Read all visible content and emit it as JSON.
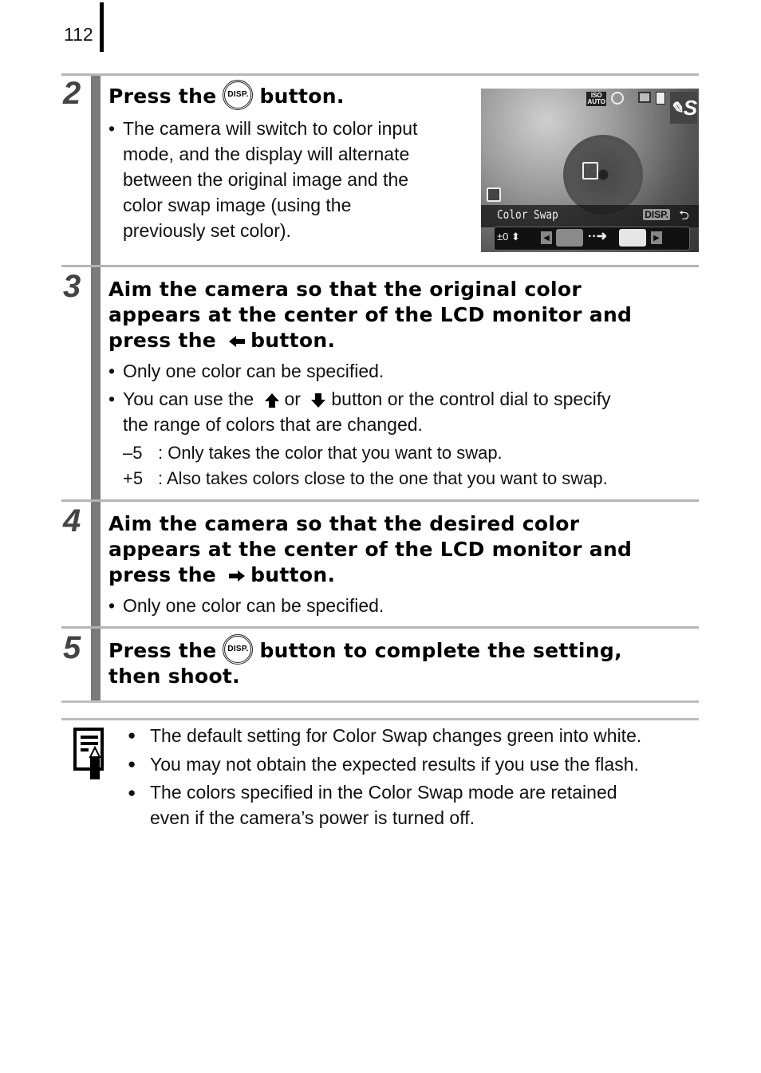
{
  "page": {
    "number": "112"
  },
  "steps": [
    {
      "number": "2",
      "heading_parts": [
        "Press the",
        "button."
      ],
      "button_icon": "disp-button-icon",
      "button_text": "DISP.",
      "bullets": [
        "The camera will switch to color input",
        "mode, and the display will alternate",
        "between the original image and the",
        "color swap image (using the",
        "previously set color)."
      ]
    },
    {
      "number": "3",
      "heading_lines": [
        "Aim the camera so that the original color",
        "appears at the center of the LCD monitor and"
      ],
      "heading_last_parts": [
        "press the",
        "button."
      ],
      "arrow_icon": "left-arrow-icon",
      "bullets": [
        "Only one color can be specified.",
        "You can use the",
        "or",
        "button or the control dial to specify",
        "the range of colors that are changed."
      ],
      "ranges": [
        {
          "key": "–5",
          "text": ": Only takes the color that you want to swap."
        },
        {
          "key": "+5",
          "text": ": Also takes colors close to the one that you want to swap."
        }
      ]
    },
    {
      "number": "4",
      "heading_lines": [
        "Aim the camera so that the desired color",
        "appears at the center of the LCD monitor and"
      ],
      "heading_last_parts": [
        "press the",
        "button."
      ],
      "arrow_icon": "right-arrow-icon",
      "bullets": [
        "Only one color can be specified."
      ]
    },
    {
      "number": "5",
      "heading_parts": [
        "Press the",
        "button to complete the setting,"
      ],
      "heading_line2": "then shoot.",
      "button_text": "DISP."
    }
  ],
  "lcd": {
    "iso": [
      "ISO",
      "AUTO"
    ],
    "mode_label": "Color Swap",
    "disp_label": "DISP.",
    "exposure": "±0",
    "mode_icon_text": "S",
    "swatch_original": "#8a8a8a",
    "swatch_target": "#e6e6e6"
  },
  "notes": [
    "The default setting for Color Swap changes green into white.",
    "You may not obtain the expected results if you use the flash.",
    "The colors specified in the Color Swap mode are retained",
    "even if the camera’s power is turned off."
  ]
}
